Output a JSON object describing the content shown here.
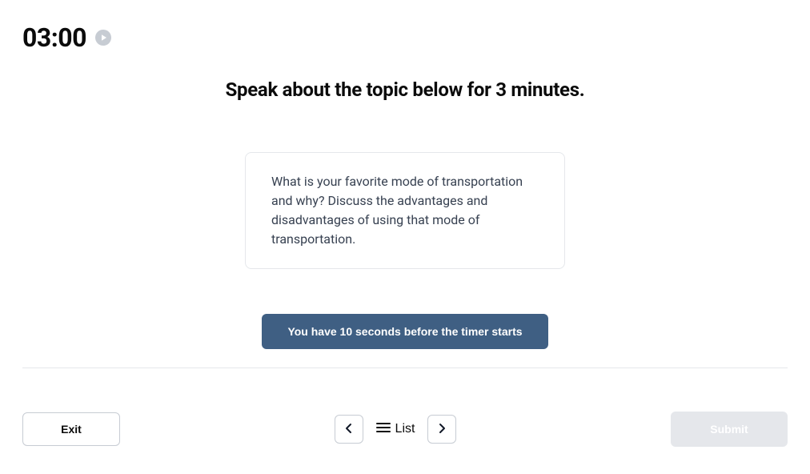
{
  "timer": {
    "value": "03:00"
  },
  "instructions": {
    "heading": "Speak about the topic below for 3 minutes."
  },
  "topic": {
    "prompt": "What is your favorite mode of transportation and why? Discuss the advantages and disadvantages of using that mode of transportation."
  },
  "countdown": {
    "label": "You have 10 seconds before the timer starts"
  },
  "footer": {
    "exit_label": "Exit",
    "list_label": "List",
    "submit_label": "Submit"
  }
}
